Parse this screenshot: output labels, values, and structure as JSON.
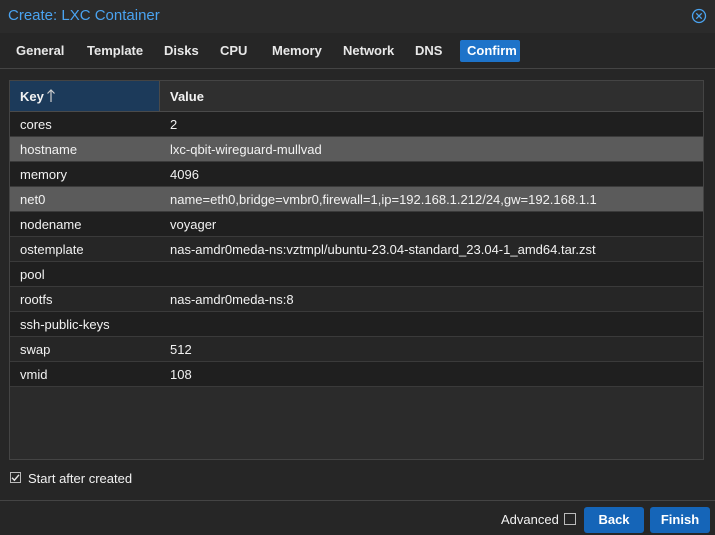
{
  "window": {
    "title": "Create: LXC Container",
    "close_icon": "close-circle-icon"
  },
  "tabs": [
    {
      "label": "General"
    },
    {
      "label": "Template"
    },
    {
      "label": "Disks"
    },
    {
      "label": "CPU"
    },
    {
      "label": "Memory"
    },
    {
      "label": "Network"
    },
    {
      "label": "DNS"
    },
    {
      "label": "Confirm",
      "active": true
    }
  ],
  "grid": {
    "columns": {
      "key": "Key",
      "key_sort_icon": "sort-ascending-arrow-icon",
      "value": "Value"
    },
    "rows": [
      {
        "key": "cores",
        "value": "2"
      },
      {
        "key": "hostname",
        "value": "lxc-qbit-wireguard-mullvad"
      },
      {
        "key": "memory",
        "value": "4096"
      },
      {
        "key": "net0",
        "value": "name=eth0,bridge=vmbr0,firewall=1,ip=192.168.1.212/24,gw=192.168.1.1"
      },
      {
        "key": "nodename",
        "value": "voyager"
      },
      {
        "key": "ostemplate",
        "value": "nas-amdr0meda-ns:vztmpl/ubuntu-23.04-standard_23.04-1_amd64.tar.zst"
      },
      {
        "key": "pool",
        "value": ""
      },
      {
        "key": "rootfs",
        "value": "nas-amdr0meda-ns:8"
      },
      {
        "key": "ssh-public-keys",
        "value": ""
      },
      {
        "key": "swap",
        "value": "512"
      },
      {
        "key": "vmid",
        "value": "108"
      }
    ]
  },
  "options": {
    "start_after_created_label": "Start after created",
    "start_after_created_checked": true
  },
  "footer": {
    "advanced_label": "Advanced",
    "advanced_checked": false,
    "back_label": "Back",
    "finish_label": "Finish"
  },
  "colors": {
    "accent": "#1e73c9",
    "title": "#4aa3f0",
    "selected_row": "#5b5b5b"
  }
}
